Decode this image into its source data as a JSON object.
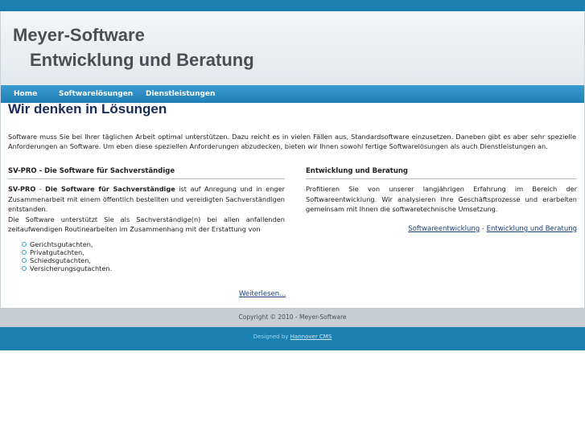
{
  "header": {
    "title": "Meyer-Software",
    "subtitle": "Entwicklung und Beratung"
  },
  "nav": {
    "items": [
      {
        "label": "Home"
      },
      {
        "label": "Softwarelösungen"
      },
      {
        "label": "Dienstleistungen"
      }
    ]
  },
  "main": {
    "title": "Wir denken in Lösungen",
    "intro": "Software muss Sie bei Ihrer täglichen Arbeit optimal unterstützen. Dazu reicht es in vielen Fällen aus, Standardsoftware einzusetzen. Daneben gibt es aber sehr spezielle Anforderungen an Software. Um eben diese speziellen Anforderungen abzudecken, bieten wir Ihnen sowohl fertige Softwarelösungen als auch Dienstleistungen an."
  },
  "left_column": {
    "title": "SV-PRO - Die Software für Sachverständige",
    "lead_strong1": "SV-PRO",
    "lead_sep": " - ",
    "lead_strong2": "Die Software für Sachverständige",
    "lead_rest": " ist auf Anregung und in enger Zusammenarbeit mit einem öffentlich bestellten und vereidigten Sachverständigen entstanden.",
    "para2": "Die Software unterstützt Sie als Sachverständige(n) bei allen anfallenden zeitaufwendigen Routinearbeiten im Zusammenhang mit der Erstattung von",
    "bullets": [
      "Gerichtsgutachten,",
      "Privatgutachten,",
      "Schiedsgutachten,",
      "Versicherungsgutachten."
    ],
    "more_link": "Weiterlesen..."
  },
  "right_column": {
    "title": "Entwicklung und Beratung",
    "para": "Profitieren Sie von unserer langjährigen Erfahrung im Bereich der Softwareentwicklung. Wir analysieren Ihre Geschäftsprozesse und erarbeiten gemeinsam mit Ihnen die softwaretechnische Umsetzung.",
    "link1": "Softwareentwicklung",
    "link_sep": " - ",
    "link2": "Entwicklung und Beratung"
  },
  "footer": {
    "copyright": "Copyright © 2010 - Meyer-Software",
    "designed_prefix": "Designed by ",
    "designed_link": "Hannover CMS"
  },
  "colors": {
    "accent": "#1a7fb1",
    "nav": "#2a8cc3",
    "title": "#1a2a5a",
    "link": "#1a3f7a"
  }
}
